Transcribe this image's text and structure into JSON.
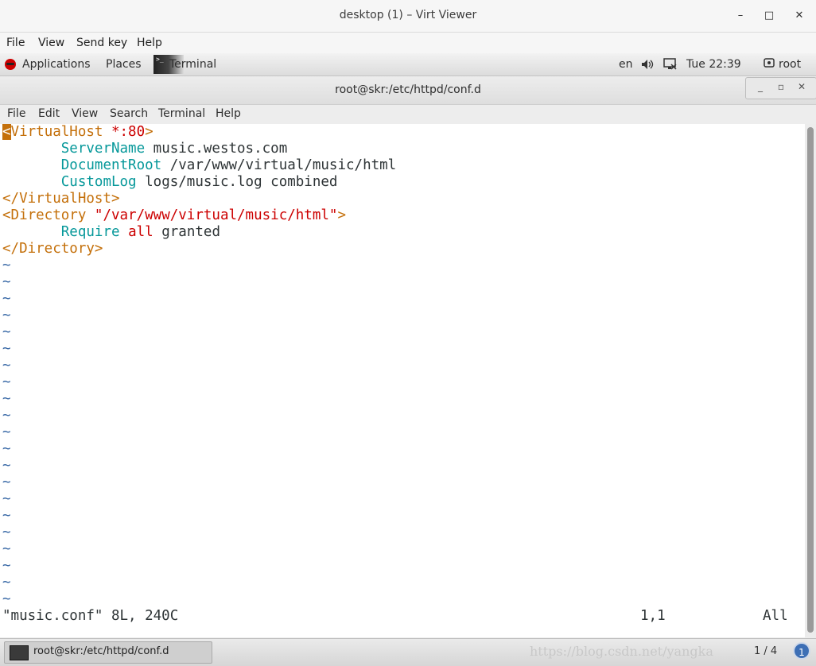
{
  "window": {
    "title": "desktop (1) – Virt Viewer",
    "controls": {
      "minimize": "–",
      "maximize": "□",
      "close": "✕"
    }
  },
  "viewer_menu": [
    "File",
    "View",
    "Send key",
    "Help"
  ],
  "panel": {
    "applications": "Applications",
    "places": "Places",
    "terminal": "Terminal",
    "lang": "en",
    "clock": "Tue 22:39",
    "user": "root",
    "icons": {
      "volume": "volume-icon",
      "network": "network-icon",
      "user": "user-icon"
    }
  },
  "terminal": {
    "title": "root@skr:/etc/httpd/conf.d",
    "menu": [
      "File",
      "Edit",
      "View",
      "Search",
      "Terminal",
      "Help"
    ]
  },
  "editor": {
    "lines": [
      {
        "parts": [
          {
            "t": "<",
            "c": "cursor"
          },
          {
            "t": "VirtualHost ",
            "c": "tag"
          },
          {
            "t": "*:80",
            "c": "str"
          },
          {
            "t": ">",
            "c": "tag"
          }
        ]
      },
      {
        "parts": [
          {
            "t": "       ",
            "c": ""
          },
          {
            "t": "ServerName",
            "c": "kw"
          },
          {
            "t": " music.westos.com",
            "c": ""
          }
        ]
      },
      {
        "parts": [
          {
            "t": "       ",
            "c": ""
          },
          {
            "t": "DocumentRoot",
            "c": "kw"
          },
          {
            "t": " /var/www/virtual/music/html",
            "c": ""
          }
        ]
      },
      {
        "parts": [
          {
            "t": "       ",
            "c": ""
          },
          {
            "t": "CustomLog",
            "c": "kw"
          },
          {
            "t": " logs/music.log combined",
            "c": ""
          }
        ]
      },
      {
        "parts": [
          {
            "t": "</VirtualHost>",
            "c": "tag"
          }
        ]
      },
      {
        "parts": [
          {
            "t": "<Directory ",
            "c": "tag"
          },
          {
            "t": "\"/var/www/virtual/music/html\"",
            "c": "str"
          },
          {
            "t": ">",
            "c": "tag"
          }
        ]
      },
      {
        "parts": [
          {
            "t": "       ",
            "c": ""
          },
          {
            "t": "Require",
            "c": "kw"
          },
          {
            "t": " ",
            "c": ""
          },
          {
            "t": "all",
            "c": "str"
          },
          {
            "t": " granted",
            "c": ""
          }
        ]
      },
      {
        "parts": [
          {
            "t": "</Directory>",
            "c": "tag"
          }
        ]
      }
    ],
    "tilde": "~",
    "tilde_count": 21,
    "status": {
      "file": "\"music.conf\" 8L, 240C",
      "position": "1,1",
      "scroll": "All"
    }
  },
  "taskbar": {
    "item": "root@skr:/etc/httpd/conf.d",
    "watermark": "https://blog.csdn.net/yangka",
    "workspace": "1 / 4",
    "badge": "1"
  }
}
